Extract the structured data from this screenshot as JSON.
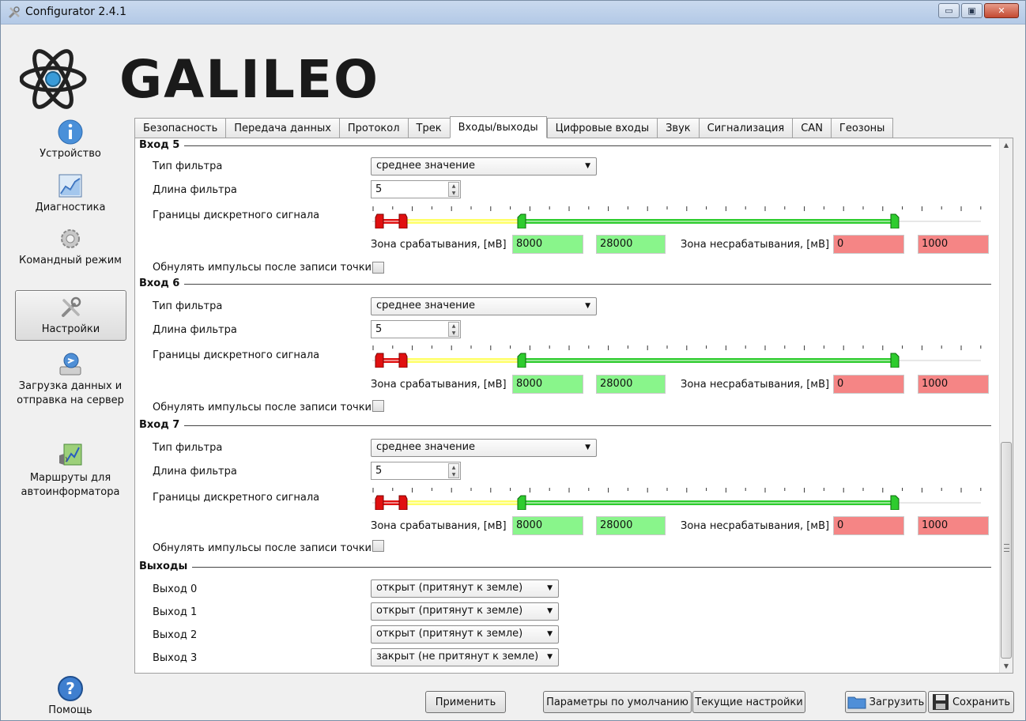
{
  "window": {
    "title": "Configurator 2.4.1",
    "minimize": "▭",
    "maximize": "▣",
    "close": "✕"
  },
  "logo": {
    "text": "GALILEO"
  },
  "sidebar": {
    "items": [
      {
        "label": "Устройство",
        "icon": "info-icon"
      },
      {
        "label": "Диагностика",
        "icon": "chart-icon"
      },
      {
        "label": "Командный режим",
        "icon": "gear-icon"
      },
      {
        "label": "Настройки",
        "icon": "tools-icon"
      },
      {
        "label": "Загрузка данных и отправка на сервер",
        "icon": "upload-drive-icon"
      },
      {
        "label": "Маршруты для автоинформатора",
        "icon": "route-map-icon"
      },
      {
        "label": "Помощь",
        "icon": "help-icon"
      }
    ]
  },
  "tabs": [
    "Безопасность",
    "Передача данных",
    "Протокол",
    "Трек",
    "Входы/выходы",
    "Цифровые входы",
    "Звук",
    "Сигнализация",
    "CAN",
    "Геозоны"
  ],
  "active_tab": "Входы/выходы",
  "labels": {
    "filter_type": "Тип фильтра",
    "filter_length": "Длина фильтра",
    "discrete_bounds": "Границы дискретного сигнала",
    "trigger_zone": "Зона срабатывания, [мВ]",
    "no_trigger_zone": "Зона несрабатывания, [мВ]",
    "reset_pulses": "Обнулять импульсы после записи точки"
  },
  "inputs": [
    {
      "title": "Вход 5",
      "filter_type": "среднее значение",
      "filter_length": "5",
      "trigger_from": "8000",
      "trigger_to": "28000",
      "no_trigger_from": "0",
      "no_trigger_to": "1000",
      "reset_pulses": false
    },
    {
      "title": "Вход 6",
      "filter_type": "среднее значение",
      "filter_length": "5",
      "trigger_from": "8000",
      "trigger_to": "28000",
      "no_trigger_from": "0",
      "no_trigger_to": "1000",
      "reset_pulses": false
    },
    {
      "title": "Вход 7",
      "filter_type": "среднее значение",
      "filter_length": "5",
      "trigger_from": "8000",
      "trigger_to": "28000",
      "no_trigger_from": "0",
      "no_trigger_to": "1000",
      "reset_pulses": false
    }
  ],
  "outputs": {
    "title": "Выходы",
    "items": [
      {
        "label": "Выход 0",
        "value": "открыт (притянут к земле)"
      },
      {
        "label": "Выход 1",
        "value": "открыт (притянут к земле)"
      },
      {
        "label": "Выход 2",
        "value": "открыт (притянут к земле)"
      },
      {
        "label": "Выход 3",
        "value": "закрыт (не притянут к земле)"
      }
    ]
  },
  "buttons": {
    "apply": "Применить",
    "defaults": "Параметры по умолчанию",
    "current": "Текущие настройки",
    "load": "Загрузить",
    "save": "Сохранить"
  },
  "colors": {
    "trigger_zone": "#89f58b",
    "no_trigger_zone": "#f58585",
    "slider_green": "#2ecc2e",
    "slider_red": "#e01010",
    "slider_yellow": "#ffff66"
  }
}
